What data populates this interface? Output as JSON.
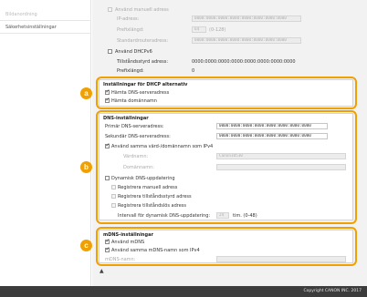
{
  "sidebar": {
    "items": [
      {
        "label": "Bildanordning"
      },
      {
        "label": "Säkerhetsinställningar"
      }
    ]
  },
  "top_section": {
    "manual_checkbox": "Använd manuell adress",
    "ip_label": "IP-adress:",
    "ip_value": "0000:0000:0000:0000:0000:0000:0000:0000",
    "prefix_label": "Prefixlängd:",
    "prefix_value": "64",
    "prefix_range": "(0-128)",
    "router_label": "Standardrouteradress:",
    "router_value": "0000:0000:0000:0000:0000:0000:0000:0000",
    "dhcp_checkbox": "Använd DHCPv6",
    "stateful_label": "Tillståndsstyrd adress:",
    "stateful_value": "0000:0000:0000:0000:0000:0000:0000:0000",
    "dhcp_prefix_label": "Prefixlängd:",
    "dhcp_prefix_value": "0"
  },
  "dhcp_panel": {
    "badge": "a",
    "title": "Inställningar för DHCP alternativ",
    "get_dns": "Hämta DNS-serveradress",
    "get_domain": "Hämta domännamn"
  },
  "dns_panel": {
    "badge": "b",
    "title": "DNS-inställningar",
    "primary_label": "Primär DNS-serveradress:",
    "primary_value": "0000:0000:0000:0000:0000:0000:0000:0000",
    "secondary_label": "Sekundär DNS-serveradress:",
    "secondary_value": "0000:0000:0000:0000:0000:0000:0000:0000",
    "same_host": "Använd samma värd-/domännamn som IPv4",
    "host_label": "Värdnamn:",
    "host_value": "Canon10530",
    "domain_label": "Domännamn:",
    "domain_value": "",
    "dyn_update": "Dynamisk DNS-uppdatering",
    "reg_manual": "Registrera manuell adress",
    "reg_stateful": "Registrera tillståndsstyrd adress",
    "reg_stateless": "Registrera tillståndslös adress",
    "interval_label": "Intervall för dynamisk DNS-uppdatering:",
    "interval_value": "24",
    "interval_unit": "tim. (0-48)"
  },
  "mdns_panel": {
    "badge": "c",
    "title": "mDNS-inställningar",
    "use_mdns": "Använd mDNS",
    "same_mdns": "Använd samma mDNS-namn som IPv4",
    "mdns_label": "mDNS-namn:",
    "mdns_value": ""
  },
  "top_link": "▲",
  "footer": {
    "copyright": "Copyright CANON INC. 2017"
  },
  "colors": {
    "accent": "#f0a000",
    "footer_bg": "#3c3c3c"
  }
}
